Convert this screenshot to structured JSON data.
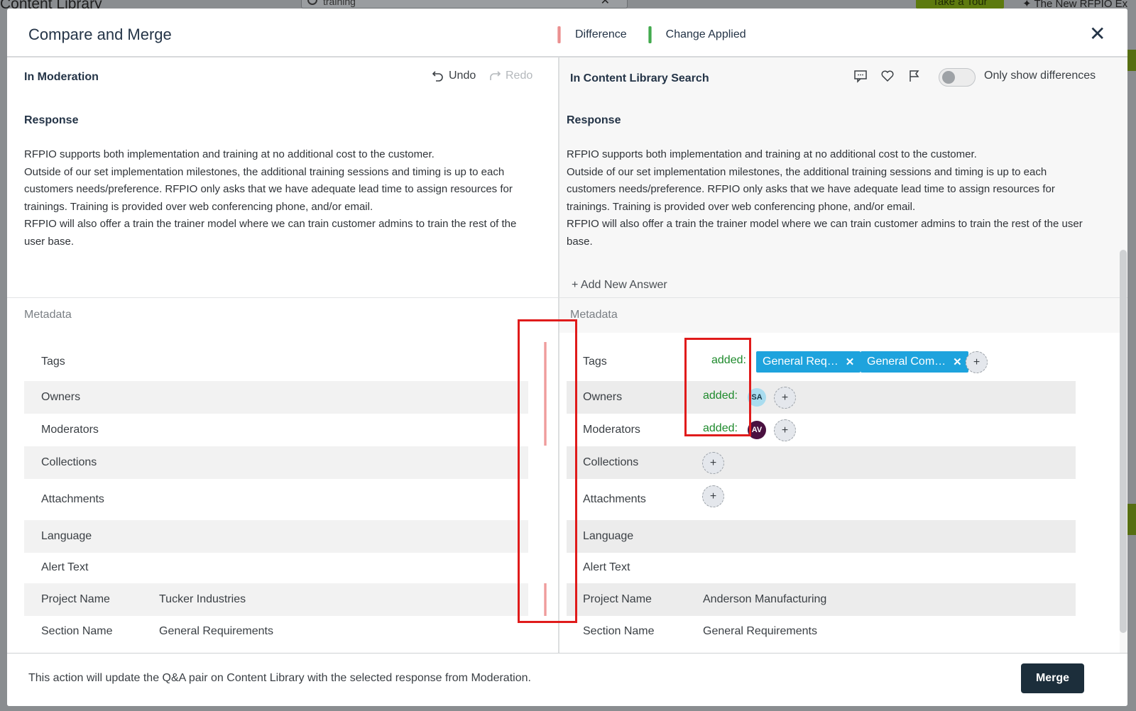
{
  "background": {
    "app_title": "Content Library",
    "search_value": "training",
    "tour_button": "Take a Tour",
    "news_label": "The New RFPIO Ex"
  },
  "modal": {
    "title": "Compare and Merge",
    "legend": {
      "difference": "Difference",
      "change_applied": "Change Applied"
    },
    "close_icon": "close-icon"
  },
  "left": {
    "header": "In Moderation",
    "undo": "Undo",
    "redo": "Redo",
    "response_label": "Response",
    "response_lines": [
      "RFPIO supports both implementation and training at no additional cost to the customer.",
      "Outside of our set implementation milestones, the additional training sessions and timing is up to each customers needs/preference. RFPIO only asks that we have adequate lead time to assign resources for trainings. Training is provided over web conferencing phone, and/or email.",
      "RFPIO will also offer a train the trainer model where we can train customer admins to train the rest of the user base."
    ],
    "metadata_label": "Metadata",
    "rows": [
      {
        "key": "Tags",
        "value": ""
      },
      {
        "key": "Owners",
        "value": ""
      },
      {
        "key": "Moderators",
        "value": ""
      },
      {
        "key": "Collections",
        "value": ""
      },
      {
        "key": "Attachments",
        "value": ""
      },
      {
        "key": "Language",
        "value": ""
      },
      {
        "key": "Alert Text",
        "value": ""
      },
      {
        "key": "Project Name",
        "value": "Tucker Industries"
      },
      {
        "key": "Section Name",
        "value": "General Requirements"
      }
    ]
  },
  "right": {
    "header": "In Content Library Search",
    "toggle_label": "Only show differences",
    "response_label": "Response",
    "response_lines": [
      "RFPIO supports both implementation and training at no additional cost to the customer.",
      "Outside of our set implementation milestones, the additional training sessions and timing is up to each customers needs/preference. RFPIO only asks that we have adequate lead time to assign resources for trainings. Training is provided over web conferencing phone, and/or email.",
      "RFPIO will also offer a train the trainer model where we can train customer admins to train the rest of the user base."
    ],
    "add_new_answer": "Add New Answer",
    "metadata_label": "Metadata",
    "added_label": "added:",
    "tags": [
      "General Req…",
      "General Com…"
    ],
    "owner_avatar": "SA",
    "moderator_avatar": "AV",
    "rows": [
      {
        "key": "Tags",
        "value": ""
      },
      {
        "key": "Owners",
        "value": ""
      },
      {
        "key": "Moderators",
        "value": ""
      },
      {
        "key": "Collections",
        "value": ""
      },
      {
        "key": "Attachments",
        "value": ""
      },
      {
        "key": "Language",
        "value": ""
      },
      {
        "key": "Alert Text",
        "value": ""
      },
      {
        "key": "Project Name",
        "value": "Anderson Manufacturing"
      },
      {
        "key": "Section Name",
        "value": "General Requirements"
      }
    ]
  },
  "footer": {
    "text": "This action will update the Q&A pair on Content Library with the selected response from Moderation.",
    "merge": "Merge"
  },
  "colors": {
    "primary_dark": "#1c2e3b",
    "tag_blue": "#1ea3dd",
    "added_green": "#1e8a2c",
    "annotation_red": "#e01b1b"
  }
}
